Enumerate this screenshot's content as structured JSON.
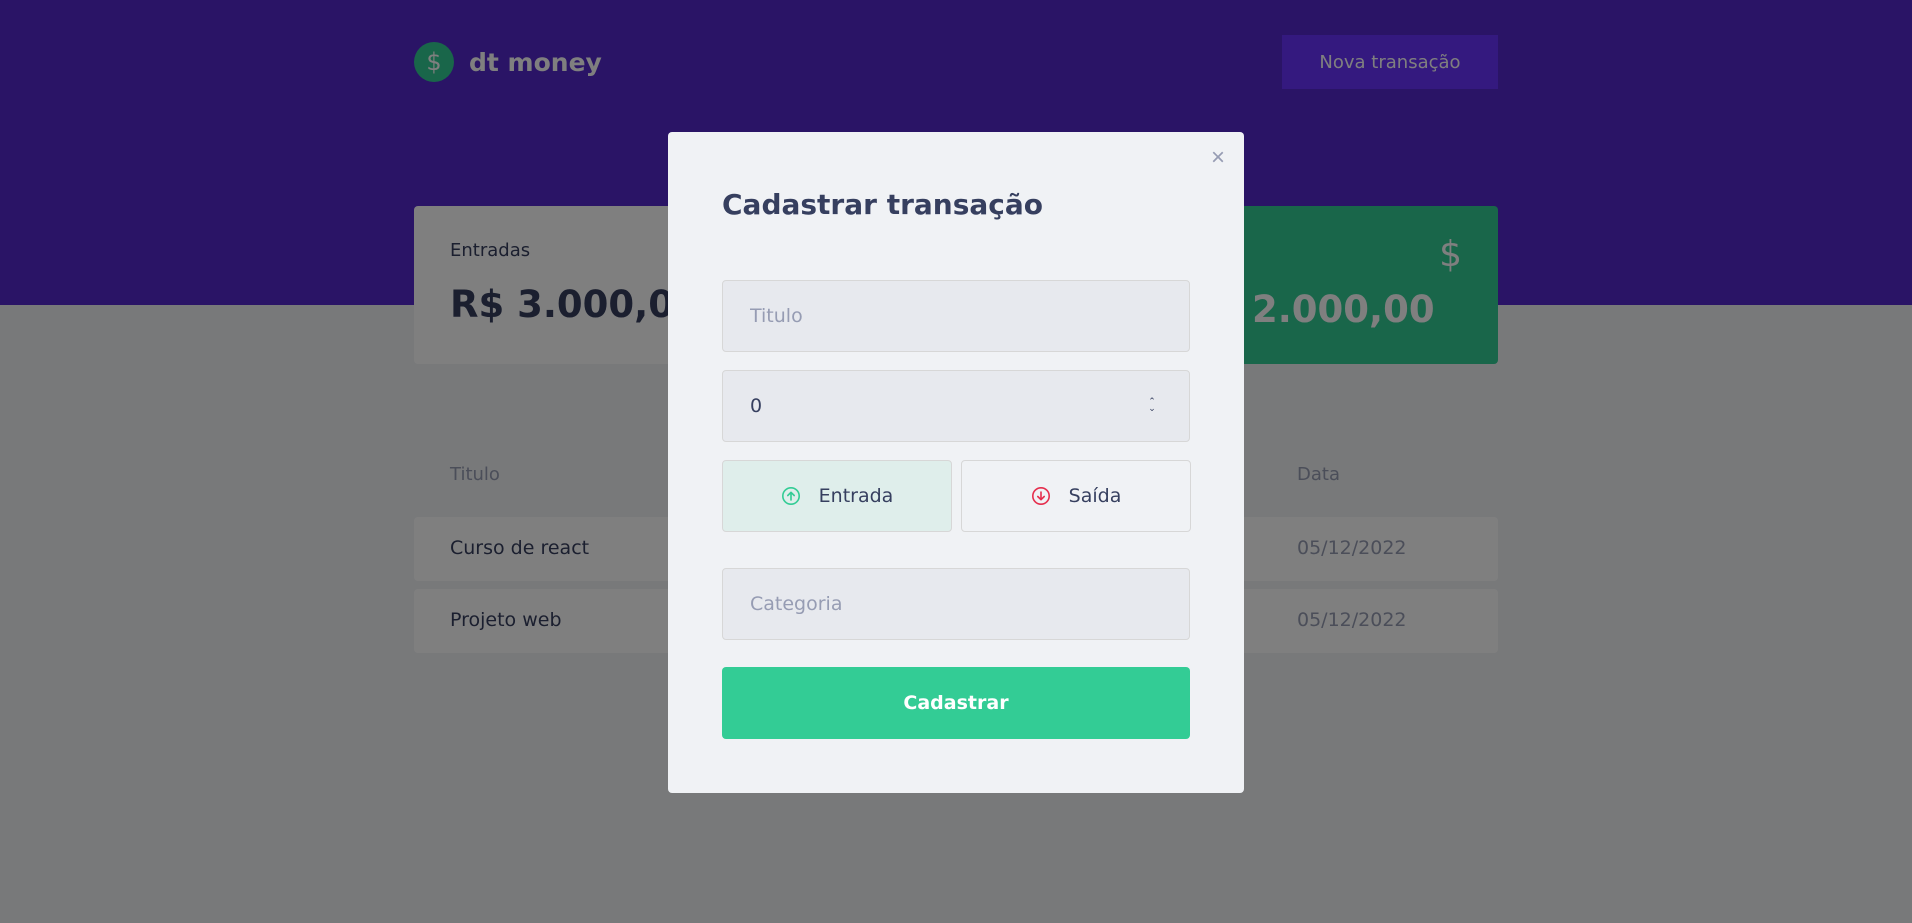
{
  "app": {
    "logo_symbol": "$",
    "name": "dt money",
    "new_transaction_label": "Nova transação"
  },
  "summary": {
    "income": {
      "label": "Entradas",
      "value": "R$ 3.000,00"
    },
    "total": {
      "value": "2.000,00",
      "icon": "dollar-icon"
    }
  },
  "table": {
    "headers": {
      "title": "Titulo",
      "date": "Data"
    },
    "rows": [
      {
        "title": "Curso de react",
        "date": "05/12/2022"
      },
      {
        "title": "Projeto web",
        "date": "05/12/2022"
      }
    ]
  },
  "modal": {
    "title": "Cadastrar transação",
    "close_symbol": "×",
    "title_field": {
      "placeholder": "Titulo",
      "value": ""
    },
    "amount_field": {
      "value": "0"
    },
    "type_income_label": "Entrada",
    "type_outcome_label": "Saída",
    "category_field": {
      "placeholder": "Categoria",
      "value": ""
    },
    "submit_label": "Cadastrar"
  },
  "colors": {
    "header_bg": "#5429cc",
    "accent_green": "#33cc95",
    "outcome_red": "#e52e4d",
    "button_purple": "#6933ff"
  }
}
